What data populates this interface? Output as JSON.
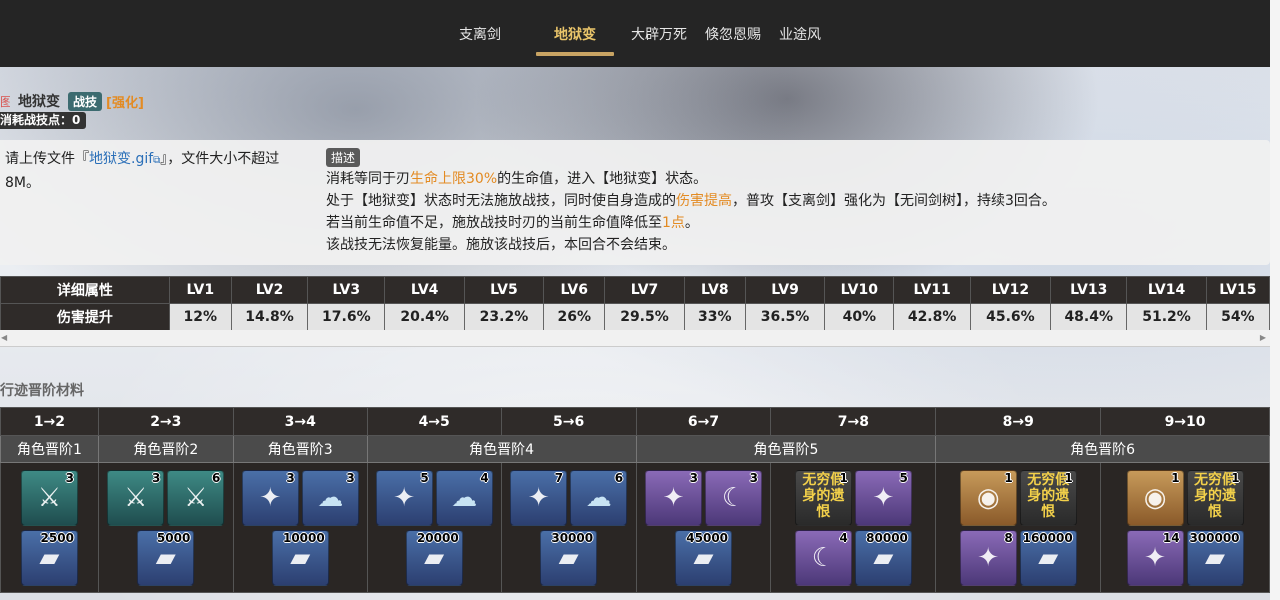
{
  "nav": {
    "tabs": [
      {
        "label": "支离剑",
        "active": false
      },
      {
        "label": "地狱变",
        "active": true
      },
      {
        "label": "大辟万死",
        "active": false
      },
      {
        "label": "倏忽恩赐",
        "active": false
      },
      {
        "label": "业途风",
        "active": false
      }
    ]
  },
  "skill": {
    "icon_fragment": "图",
    "name": "地狱变",
    "type_badge": "战技",
    "enhanced_tag": "[强化]",
    "cost_text": "消耗战技点：0"
  },
  "upload": {
    "prefix": "请上传文件『",
    "file_link": "地狱变.gif",
    "suffix": "』，文件大小不超过8M。"
  },
  "description": {
    "label": "描述",
    "line1": {
      "a": "消耗等同于刃",
      "hl": "生命上限30%",
      "b": "的生命值，进入【地狱变】状态。"
    },
    "line2": {
      "a": "处于【地狱变】状态时无法施放战技，同时使自身造成的",
      "hl": "伤害提高",
      "b": "，普攻【支离剑】强化为【无间剑树】，持续3回合。"
    },
    "line3": {
      "a": "若当前生命值不足，施放战技时刃的当前生命值降低至",
      "hl": "1点",
      "b": "。"
    },
    "line4": "该战技无法恢复能量。施放该战技后，本回合不会结束。"
  },
  "levels": {
    "header_label": "详细属性",
    "row_label": "伤害提升",
    "columns": [
      "LV1",
      "LV2",
      "LV3",
      "LV4",
      "LV5",
      "LV6",
      "LV7",
      "LV8",
      "LV9",
      "LV10",
      "LV11",
      "LV12",
      "LV13",
      "LV14",
      "LV15"
    ],
    "values": [
      "12%",
      "14.8%",
      "17.6%",
      "20.4%",
      "23.2%",
      "26%",
      "29.5%",
      "33%",
      "36.5%",
      "40%",
      "42.8%",
      "45.6%",
      "48.4%",
      "51.2%",
      "54%"
    ]
  },
  "materials": {
    "section_title": "行迹晋阶材料",
    "stages": [
      "1→2",
      "2→3",
      "3→4",
      "4→5",
      "5→6",
      "6→7",
      "7→8",
      "8→9",
      "9→10"
    ],
    "ranks": [
      "角色晋阶1",
      "角色晋阶2",
      "角色晋阶3",
      "角色晋阶4",
      "角色晋阶5",
      "角色晋阶6"
    ],
    "columns": [
      {
        "rows": [
          [
            {
              "r": "green",
              "n": "3",
              "g": "sword-icon"
            }
          ],
          [
            {
              "r": "blue",
              "n": "2500",
              "g": "credit-icon"
            }
          ]
        ]
      },
      {
        "rows": [
          [
            {
              "r": "green",
              "n": "3",
              "g": "sword-icon"
            },
            {
              "r": "green",
              "n": "6",
              "g": "sword-icon"
            }
          ],
          [
            {
              "r": "blue",
              "n": "5000",
              "g": "credit-icon"
            }
          ]
        ]
      },
      {
        "rows": [
          [
            {
              "r": "blue",
              "n": "3",
              "g": "blade-icon"
            },
            {
              "r": "blue",
              "n": "3",
              "g": "ghost-icon"
            }
          ],
          [
            {
              "r": "blue",
              "n": "10000",
              "g": "credit-icon"
            }
          ]
        ]
      },
      {
        "rows": [
          [
            {
              "r": "blue",
              "n": "5",
              "g": "blade-icon"
            },
            {
              "r": "blue",
              "n": "4",
              "g": "ghost-icon"
            }
          ],
          [
            {
              "r": "blue",
              "n": "20000",
              "g": "credit-icon"
            }
          ]
        ]
      },
      {
        "rows": [
          [
            {
              "r": "blue",
              "n": "7",
              "g": "blade-icon"
            },
            {
              "r": "blue",
              "n": "6",
              "g": "ghost-icon"
            }
          ],
          [
            {
              "r": "blue",
              "n": "30000",
              "g": "credit-icon"
            }
          ]
        ]
      },
      {
        "rows": [
          [
            {
              "r": "purple",
              "n": "3",
              "g": "blade-icon"
            },
            {
              "r": "purple",
              "n": "3",
              "g": "crescent-icon"
            }
          ],
          [
            {
              "r": "blue",
              "n": "45000",
              "g": "credit-icon"
            }
          ]
        ]
      },
      {
        "rows": [
          [
            {
              "r": "dark",
              "n": "1",
              "g": "text",
              "t": "无穷假身的遗恨"
            },
            {
              "r": "purple",
              "n": "5",
              "g": "blade-icon"
            }
          ],
          [
            {
              "r": "purple",
              "n": "4",
              "g": "crescent-icon"
            },
            {
              "r": "blue",
              "n": "80000",
              "g": "credit-icon"
            }
          ]
        ]
      },
      {
        "rows": [
          [
            {
              "r": "gold",
              "n": "1",
              "g": "orb-icon"
            },
            {
              "r": "dark",
              "n": "1",
              "g": "text",
              "t": "无穷假身的遗恨"
            }
          ],
          [
            {
              "r": "purple",
              "n": "8",
              "g": "blade-icon"
            },
            {
              "r": "blue",
              "n": "160000",
              "g": "credit-icon"
            }
          ]
        ]
      },
      {
        "rows": [
          [
            {
              "r": "gold",
              "n": "1",
              "g": "orb-icon"
            },
            {
              "r": "dark",
              "n": "1",
              "g": "text",
              "t": "无穷假身的遗恨"
            }
          ],
          [
            {
              "r": "purple",
              "n": "14",
              "g": "blade-icon"
            },
            {
              "r": "blue",
              "n": "300000",
              "g": "credit-icon"
            }
          ]
        ]
      }
    ]
  }
}
